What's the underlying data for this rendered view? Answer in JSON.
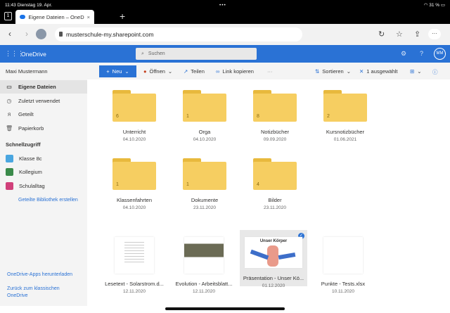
{
  "status": {
    "time": "11:43",
    "date": "Dienstag 19. Apr.",
    "battery": "31 %"
  },
  "browser": {
    "tab_count": "1",
    "tab_title": "Eigene Dateien – OneD",
    "url": "musterschule-my.sharepoint.com"
  },
  "suite": {
    "app": "OneDrive",
    "search_placeholder": "Suchen",
    "user_initials": "MM"
  },
  "toolbar": {
    "user": "Maxi Mustermann",
    "new": "Neu",
    "open": "Öffnen",
    "share": "Teilen",
    "copy_link": "Link kopieren",
    "more": "···",
    "sort": "Sortieren",
    "selected": "1 ausgewählt"
  },
  "sidebar": {
    "items": [
      {
        "label": "Eigene Dateien"
      },
      {
        "label": "Zuletzt verwendet"
      },
      {
        "label": "Geteilt"
      },
      {
        "label": "Papierkorb"
      }
    ],
    "quick_heading": "Schnellzugriff",
    "quick": [
      {
        "label": "Klasse 8c",
        "color": "#4aa6e0"
      },
      {
        "label": "Kollegium",
        "color": "#3a8a4a"
      },
      {
        "label": "Schulalltag",
        "color": "#d0407a"
      }
    ],
    "create_library": "Geteilte Bibliothek erstellen",
    "download_apps": "OneDrive-Apps herunterladen",
    "classic": "Zurück zum klassischen OneDrive"
  },
  "folders": [
    {
      "name": "Unterricht",
      "date": "04.10.2020",
      "count": "6"
    },
    {
      "name": "Orga",
      "date": "04.10.2020",
      "count": "1"
    },
    {
      "name": "Notizbücher",
      "date": "09.09.2020",
      "count": "8"
    },
    {
      "name": "Kursnotizbücher",
      "date": "01.06.2021",
      "count": "2"
    },
    {
      "name": "Klassenfahrten",
      "date": "04.10.2020",
      "count": "1"
    },
    {
      "name": "Dokumente",
      "date": "23.11.2020",
      "count": "1"
    },
    {
      "name": "Bilder",
      "date": "23.11.2020",
      "count": "4"
    }
  ],
  "files": [
    {
      "name": "Lesetext - Solarstrom.d...",
      "date": "12.11.2020"
    },
    {
      "name": "Evolution - Arbeitsblatt...",
      "date": "12.11.2020"
    },
    {
      "name": "Präsentation - Unser Kö...",
      "date": "01.12.2020",
      "thumb_title": "Unser Körper"
    },
    {
      "name": "Punkte - Tests.xlsx",
      "date": "10.11.2020"
    }
  ]
}
